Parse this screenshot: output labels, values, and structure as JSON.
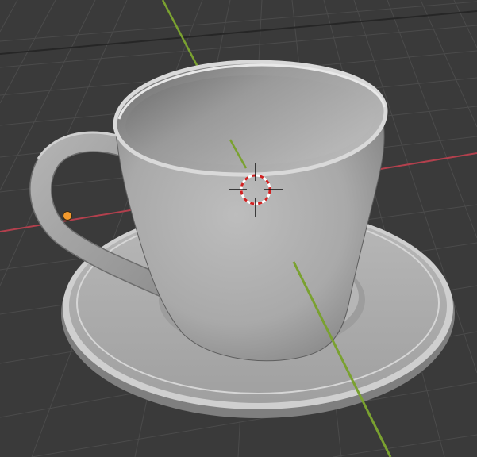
{
  "app": {
    "name": "3D viewport",
    "shading_mode": "solid"
  },
  "scene": {
    "objects": [
      "cup",
      "saucer"
    ],
    "background_color": "#3a3a3a",
    "grid_line_color": "#4a4a4a",
    "x_axis_color": "#b3404d",
    "y_axis_color": "#7aa130",
    "object_origin_color": "#f29a2e",
    "cursor_ring_colors": [
      "#d02020",
      "#ffffff"
    ],
    "mesh_color": "#a8a8a8"
  }
}
